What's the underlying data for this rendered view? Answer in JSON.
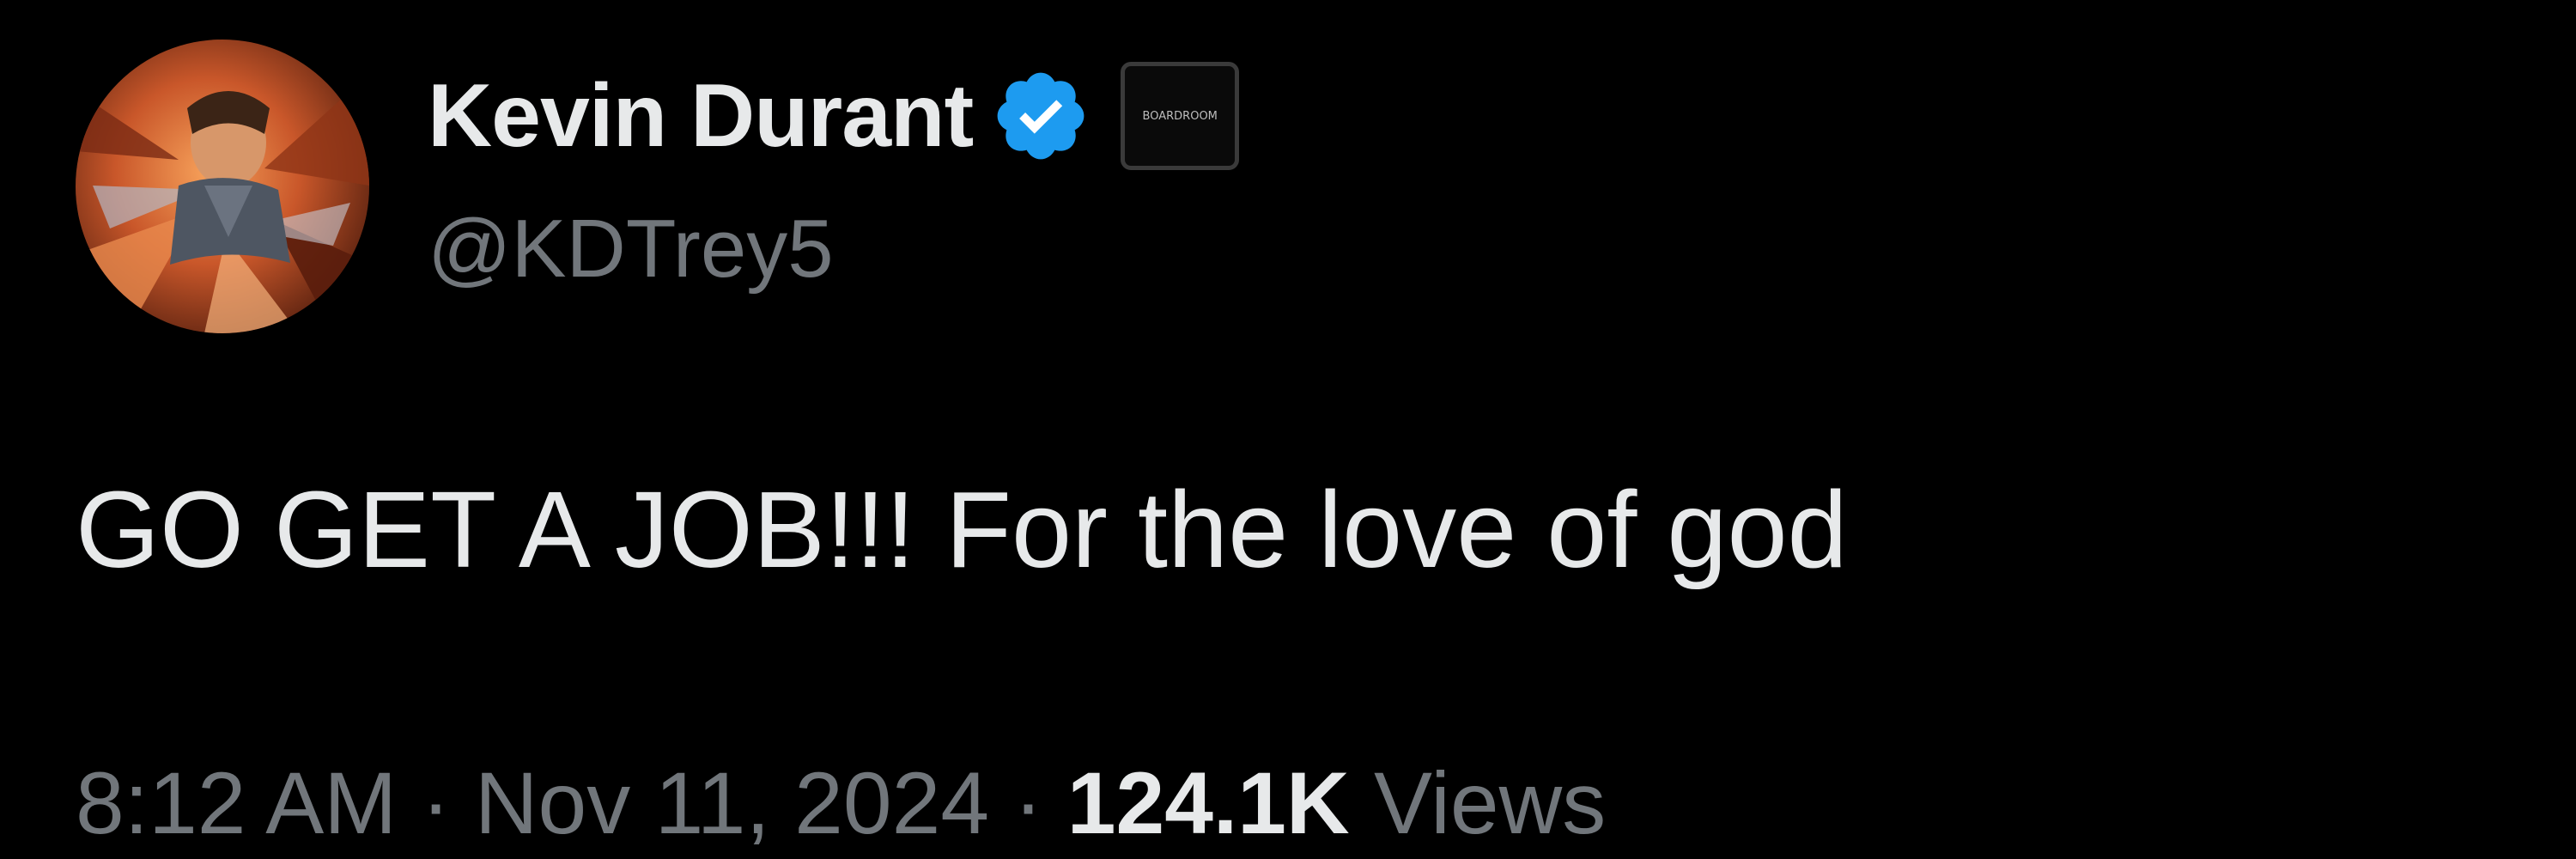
{
  "tweet": {
    "author": {
      "display_name": "Kevin Durant",
      "handle": "@KDTrey5",
      "verified": true,
      "verified_icon": "verified-badge-icon",
      "affiliation_badge_text": "BOARDROOM"
    },
    "text": "GO GET A JOB!!! For the love of god",
    "meta": {
      "time": "8:12 AM",
      "separator": "·",
      "date": "Nov 11, 2024",
      "views_count": "124.1K",
      "views_label": "Views"
    }
  },
  "colors": {
    "background": "#000000",
    "primary_text": "#e7e9ea",
    "secondary_text": "#71767b",
    "verified_blue": "#1d9bf0"
  }
}
